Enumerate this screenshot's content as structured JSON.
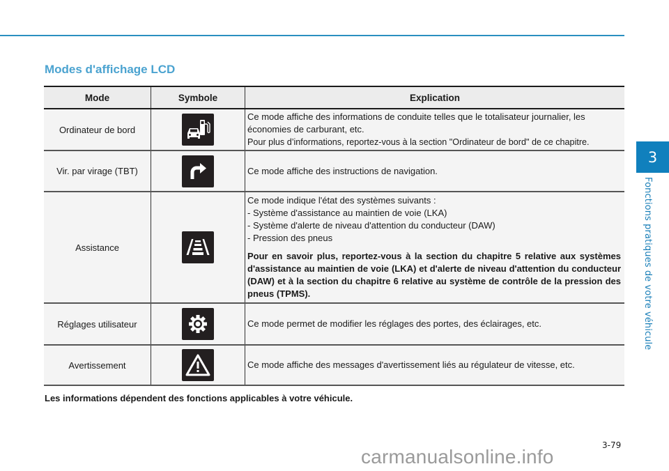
{
  "chapter": {
    "number": "3",
    "label": "Fonctions pratiques de votre véhicule"
  },
  "section_title": "Modes d'affichage LCD",
  "table": {
    "headers": {
      "mode": "Mode",
      "symbol": "Symbole",
      "explanation": "Explication"
    },
    "rows": [
      {
        "mode": "Ordinateur de bord",
        "icon": "trip-computer-icon",
        "lines": [
          "Ce mode affiche des informations de conduite telles que le totalisateur journalier, les économies de carburant, etc.",
          "Pour plus d’informations, reportez-vous à la section \"Ordinateur de bord\" de ce chapitre."
        ]
      },
      {
        "mode": "Vir. par virage (TBT)",
        "icon": "turn-right-arrow-icon",
        "lines": [
          "Ce mode affiche des instructions de navigation."
        ]
      },
      {
        "mode": "Assistance",
        "icon": "lane-assist-icon",
        "lines": [
          "Ce mode indique l'état des systèmes suivants  :",
          "- Système d'assistance au maintien de voie (LKA)",
          "- Système d'alerte de niveau d'attention du conducteur (DAW)",
          "- Pression des pneus"
        ],
        "bold_note": "Pour en savoir plus, reportez-vous à la section du chapitre 5 relative aux systèmes d'assistance au maintien de voie (LKA) et d'alerte de niveau d'attention du conducteur (DAW) et à la section du chapitre 6 relative au système de contrôle de la pression des pneus (TPMS)."
      },
      {
        "mode": "Réglages utilisateur",
        "icon": "gear-icon",
        "lines": [
          "Ce mode permet de modifier les réglages des portes, des éclairages, etc."
        ]
      },
      {
        "mode": "Avertissement",
        "icon": "warning-triangle-icon",
        "lines": [
          "Ce mode affiche des messages d'avertissement liés au régulateur de vitesse, etc."
        ]
      }
    ]
  },
  "footnote": "Les informations dépendent des fonctions applicables à votre véhicule.",
  "page_number": "3-79",
  "watermark": "carmanualsonline.info",
  "colors": {
    "accent": "#2a8fc0",
    "title": "#4ba3d0",
    "chapter_tab": "#1080bd",
    "icon_bg": "#231f20"
  }
}
